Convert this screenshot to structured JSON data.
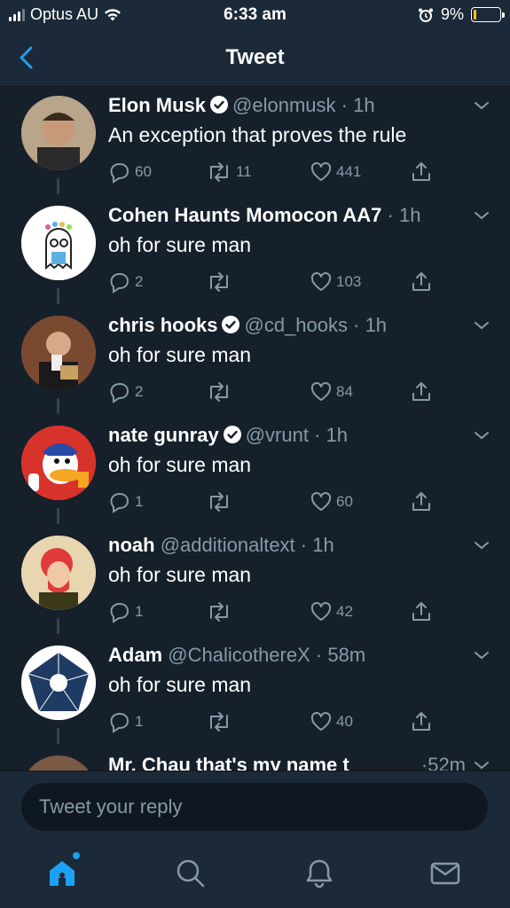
{
  "status_bar": {
    "carrier": "Optus AU",
    "time": "6:33 am",
    "battery": "9%"
  },
  "nav": {
    "title": "Tweet"
  },
  "tweets": [
    {
      "name": "Elon Musk",
      "verified": true,
      "handle": "@elonmusk",
      "time": "1h",
      "text": "An exception that proves the rule",
      "replies": "60",
      "retweets": "11",
      "likes": "441",
      "avatar_color": "#6b4a3a"
    },
    {
      "name": "Cohen Haunts Momocon AA7",
      "verified": false,
      "handle": "",
      "time": "1h",
      "text": "oh for sure man",
      "replies": "2",
      "retweets": "",
      "likes": "103",
      "avatar_color": "#ffffff"
    },
    {
      "name": "chris hooks",
      "verified": true,
      "handle": "@cd_hooks",
      "time": "1h",
      "text": "oh for sure man",
      "replies": "2",
      "retweets": "",
      "likes": "84",
      "avatar_color": "#5a3a2a"
    },
    {
      "name": "nate gunray",
      "verified": true,
      "handle": "@vrunt",
      "time": "1h",
      "text": "oh for sure man",
      "replies": "1",
      "retweets": "",
      "likes": "60",
      "avatar_color": "#d8332a"
    },
    {
      "name": "noah",
      "verified": false,
      "handle": "@additionaltext",
      "time": "1h",
      "text": "oh for sure man",
      "replies": "1",
      "retweets": "",
      "likes": "42",
      "avatar_color": "#e8d6b0"
    },
    {
      "name": "Adam",
      "verified": false,
      "handle": "@ChalicothereX",
      "time": "58m",
      "text": "oh for sure man",
      "replies": "1",
      "retweets": "",
      "likes": "40",
      "avatar_color": "#1f3b63"
    },
    {
      "name": "Mr. Chau that's my name t",
      "verified": false,
      "handle": "",
      "time": "52m",
      "text": "",
      "replies": "",
      "retweets": "",
      "likes": "",
      "avatar_color": "#7a5a45"
    }
  ],
  "reply": {
    "placeholder": "Tweet your reply"
  },
  "tabbar": {
    "items": [
      "home-icon",
      "search-icon",
      "bell-icon",
      "mail-icon"
    ],
    "accent": "#1da1f2",
    "inactive": "#8899a6"
  },
  "colors": {
    "background": "#15202b",
    "bar": "#1c2938",
    "secondary_text": "#8899a6",
    "accent": "#1da1f2"
  }
}
